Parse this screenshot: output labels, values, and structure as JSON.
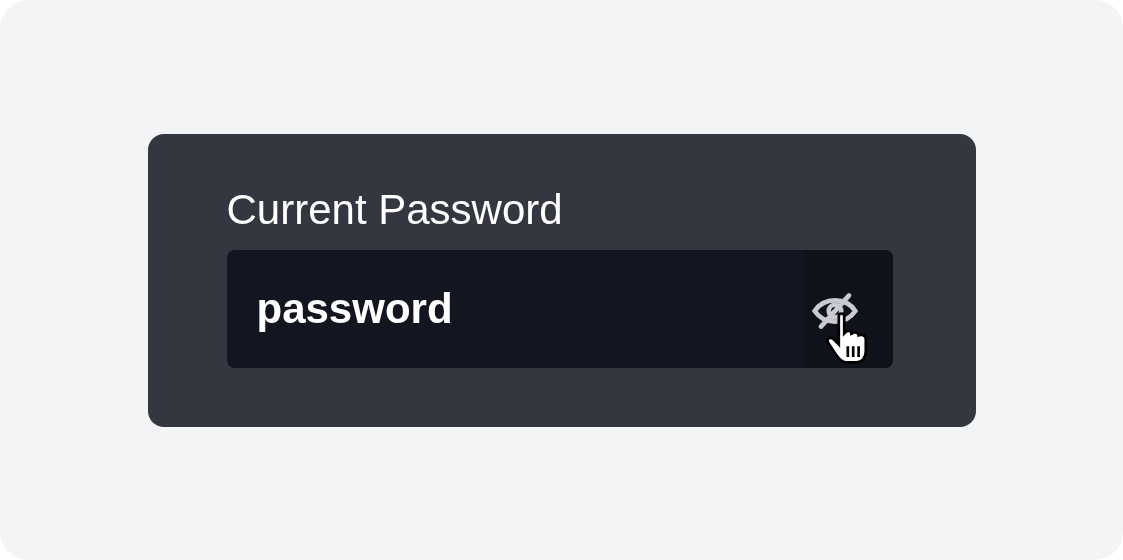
{
  "field": {
    "label": "Current Password",
    "value": "password",
    "visible": true
  }
}
